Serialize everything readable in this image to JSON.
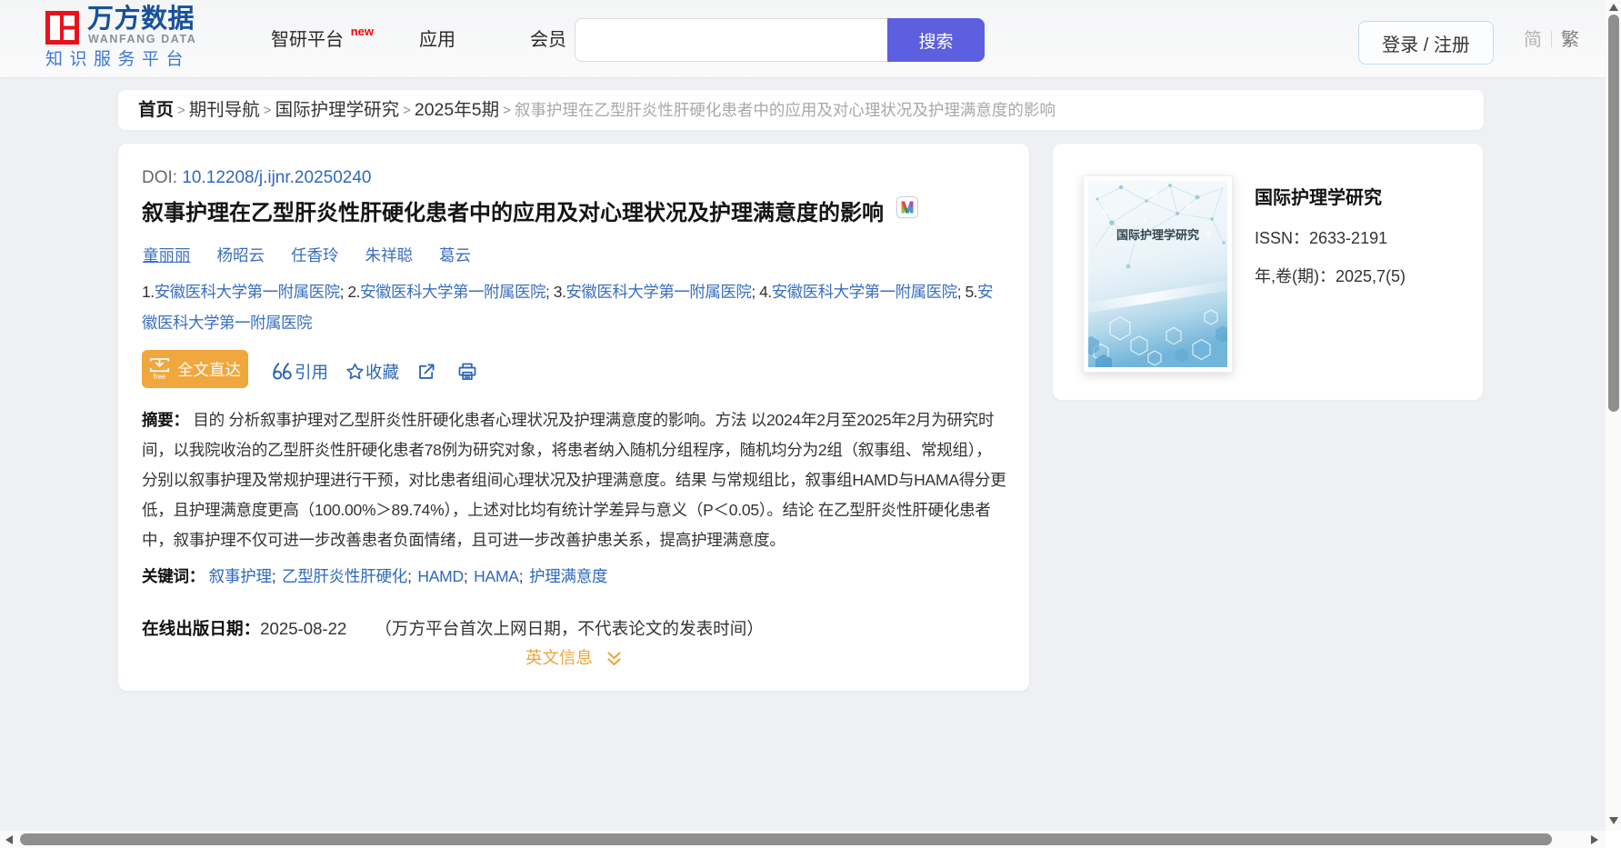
{
  "header": {
    "logo": {
      "brand_cn": "万方数据",
      "brand_en": "WANFANG DATA",
      "tagline": "知识服务平台"
    },
    "nav": [
      {
        "label": "智研平台",
        "badge": "new"
      },
      {
        "label": "应用"
      },
      {
        "label": "会员"
      }
    ],
    "search": {
      "value": "",
      "placeholder": "",
      "button_label": "搜索"
    },
    "login_label": "登录 / 注册",
    "lang": {
      "simplified": "简",
      "traditional": "繁"
    }
  },
  "breadcrumb": {
    "separator": ">",
    "items": [
      "首页",
      "期刊导航",
      "国际护理学研究",
      "2025年5期"
    ],
    "current": "叙事护理在乙型肝炎性肝硬化患者中的应用及对心理状况及护理满意度的影响"
  },
  "article": {
    "doi_label": "DOI:",
    "doi": "10.12208/j.ijnr.20250240",
    "title": "叙事护理在乙型肝炎性肝硬化患者中的应用及对心理状况及护理满意度的影响",
    "title_badge": "M",
    "authors": [
      "童丽丽",
      "杨昭云",
      "任香玲",
      "朱祥聪",
      "葛云"
    ],
    "aff_separator": ";",
    "affiliations": [
      {
        "num": "1.",
        "name": "安徽医科大学第一附属医院"
      },
      {
        "num": "2.",
        "name": "安徽医科大学第一附属医院"
      },
      {
        "num": "3.",
        "name": "安徽医科大学第一附属医院"
      },
      {
        "num": "4.",
        "name": "安徽医科大学第一附属医院"
      },
      {
        "num": "5.",
        "name": "安徽医科大学第一附属医院"
      }
    ],
    "actions": {
      "fulltext_label": "全文直达",
      "fulltext_free": "free",
      "cite_label": "引用",
      "favorite_label": "收藏"
    },
    "abstract_label": "摘要：",
    "abstract": "目的 分析叙事护理对乙型肝炎性肝硬化患者心理状况及护理满意度的影响。方法 以2024年2月至2025年2月为研究时间，以我院收治的乙型肝炎性肝硬化患者78例为研究对象，将患者纳入随机分组程序，随机均分为2组（叙事组、常规组），分别以叙事护理及常规护理进行干预，对比患者组间心理状况及护理满意度。结果 与常规组比，叙事组HAMD与HAMA得分更低，且护理满意度更高（100.00%＞89.74%），上述对比均有统计学差异与意义（P＜0.05）。结论 在乙型肝炎性肝硬化患者中，叙事护理不仅可进一步改善患者负面情绪，且可进一步改善护患关系，提高护理满意度。",
    "keywords_label": "关键词：",
    "keyword_separator": ";",
    "keywords": [
      "叙事护理",
      "乙型肝炎性肝硬化",
      "HAMD",
      "HAMA",
      "护理满意度"
    ],
    "published_label": "在线出版日期：",
    "published_date": "2025-08-22",
    "published_note": "（万方平台首次上网日期，不代表论文的发表时间）",
    "english_toggle_label": "英文信息"
  },
  "journal": {
    "cover_title": "国际护理学研究",
    "name": "国际护理学研究",
    "issn_label": "ISSN：",
    "issn": "2633-2191",
    "volume_label": "年,卷(期)：",
    "volume": "2025,7(5)"
  },
  "icons": {
    "logo": "wanfang-grid-logo",
    "fulltext": "download-tray-icon",
    "cite": "quote-icon",
    "favorite": "star-icon",
    "share": "share-icon",
    "print": "printer-icon",
    "english_toggle": "double-chevron-down-icon"
  },
  "colors": {
    "accent_orange": "#efa63e",
    "accent_purple": "#5b5fe0",
    "link_blue": "#2e68c0",
    "brand_red": "#e8121f",
    "brand_navy": "#17519c",
    "page_background": "#eef0f4"
  }
}
